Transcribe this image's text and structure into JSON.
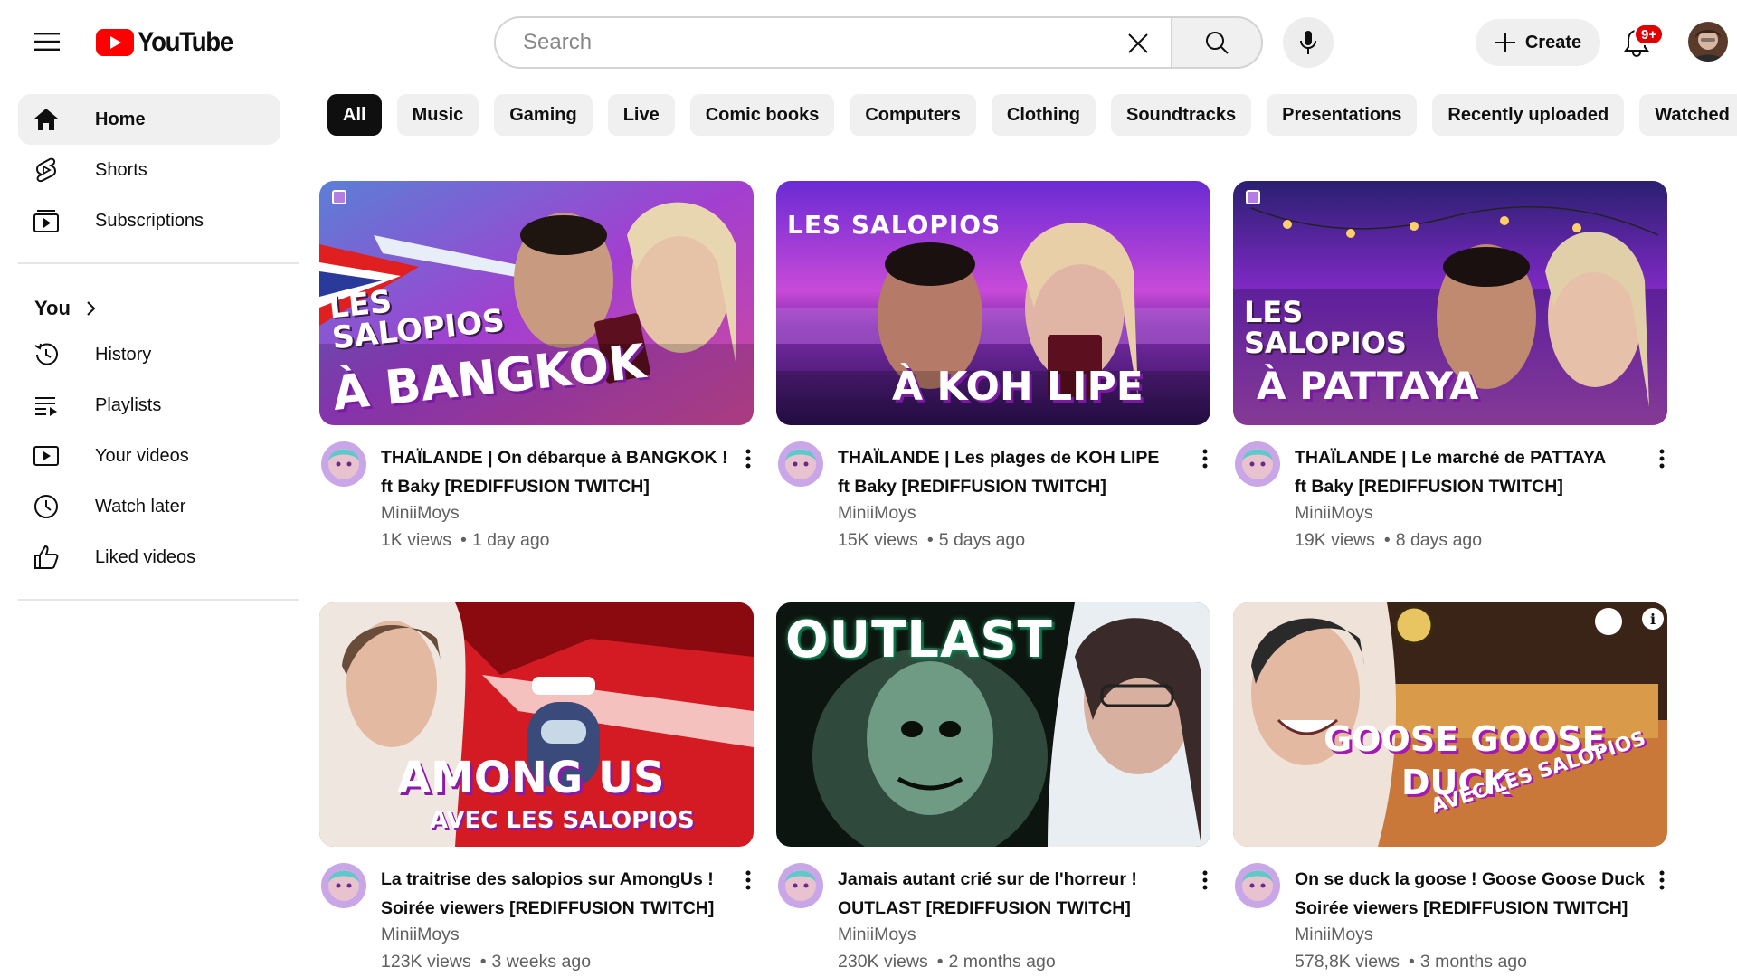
{
  "header": {
    "logo_text": "YouTube",
    "search_placeholder": "Search",
    "create_label": "Create",
    "notification_count": "9+",
    "colors": {
      "brand_red": "#ff0000",
      "badge_red": "#e00000"
    }
  },
  "sidebar": {
    "main_items": [
      {
        "label": "Home",
        "icon": "home-icon",
        "active": true
      },
      {
        "label": "Shorts",
        "icon": "shorts-icon"
      },
      {
        "label": "Subscriptions",
        "icon": "subscriptions-icon"
      }
    ],
    "you_label": "You",
    "you_items": [
      {
        "label": "History",
        "icon": "history-icon"
      },
      {
        "label": "Playlists",
        "icon": "playlists-icon"
      },
      {
        "label": "Your videos",
        "icon": "your-videos-icon"
      },
      {
        "label": "Watch later",
        "icon": "watch-later-icon"
      },
      {
        "label": "Liked videos",
        "icon": "liked-videos-icon"
      }
    ]
  },
  "chips": [
    "All",
    "Music",
    "Gaming",
    "Live",
    "Comic books",
    "Computers",
    "Clothing",
    "Soundtracks",
    "Presentations",
    "Recently uploaded",
    "Watched"
  ],
  "videos": [
    {
      "title_line1": "THAÏLANDE | On débarque à BANGKOK !",
      "title_line2": "ft Baky [REDIFFUSION TWITCH]",
      "channel": "MiniiMoys",
      "views": "1K views",
      "age": "1 day ago",
      "thumb_text_top": "LES SALOPIOS",
      "thumb_text_main": "À BANGKOK"
    },
    {
      "title_line1": "THAÏLANDE |  Les plages de KOH LIPE",
      "title_line2": "ft Baky [REDIFFUSION TWITCH]",
      "channel": "MiniiMoys",
      "views": "15K views",
      "age": "5 days ago",
      "thumb_text_top": "LES SALOPIOS",
      "thumb_text_main": "À KOH LIPE"
    },
    {
      "title_line1": "THAÏLANDE |  Le marché de PATTAYA",
      "title_line2": "ft Baky [REDIFFUSION TWITCH]",
      "channel": "MiniiMoys",
      "views": "19K views",
      "age": "8 days ago",
      "thumb_text_top": "LES SALOPIOS",
      "thumb_text_main": "À PATTAYA"
    },
    {
      "title_line1": "La traitrise des salopios sur AmongUs !",
      "title_line2": "Soirée viewers [REDIFFUSION TWITCH]",
      "channel": "MiniiMoys",
      "views": "123K views",
      "age": "3 weeks ago",
      "thumb_text_top": "AMONG US",
      "thumb_text_main": "AVEC LES SALOPIOS"
    },
    {
      "title_line1": "Jamais autant crié sur de l'horreur !",
      "title_line2": "OUTLAST [REDIFFUSION TWITCH]",
      "channel": "MiniiMoys",
      "views": "230K views",
      "age": "2 months ago",
      "thumb_text_top": "OUTLAST",
      "thumb_text_main": ""
    },
    {
      "title_line1": "On se duck la goose ! Goose Goose Duck",
      "title_line2": "Soirée viewers [REDIFFUSION TWITCH]",
      "channel": "MiniiMoys",
      "views": "578,8K views",
      "age": "3 months ago",
      "thumb_text_top": "GOOSE GOOSE",
      "thumb_text_main": "DUCK",
      "thumb_text_extra": "AVEC LES SALOPIOS"
    }
  ]
}
